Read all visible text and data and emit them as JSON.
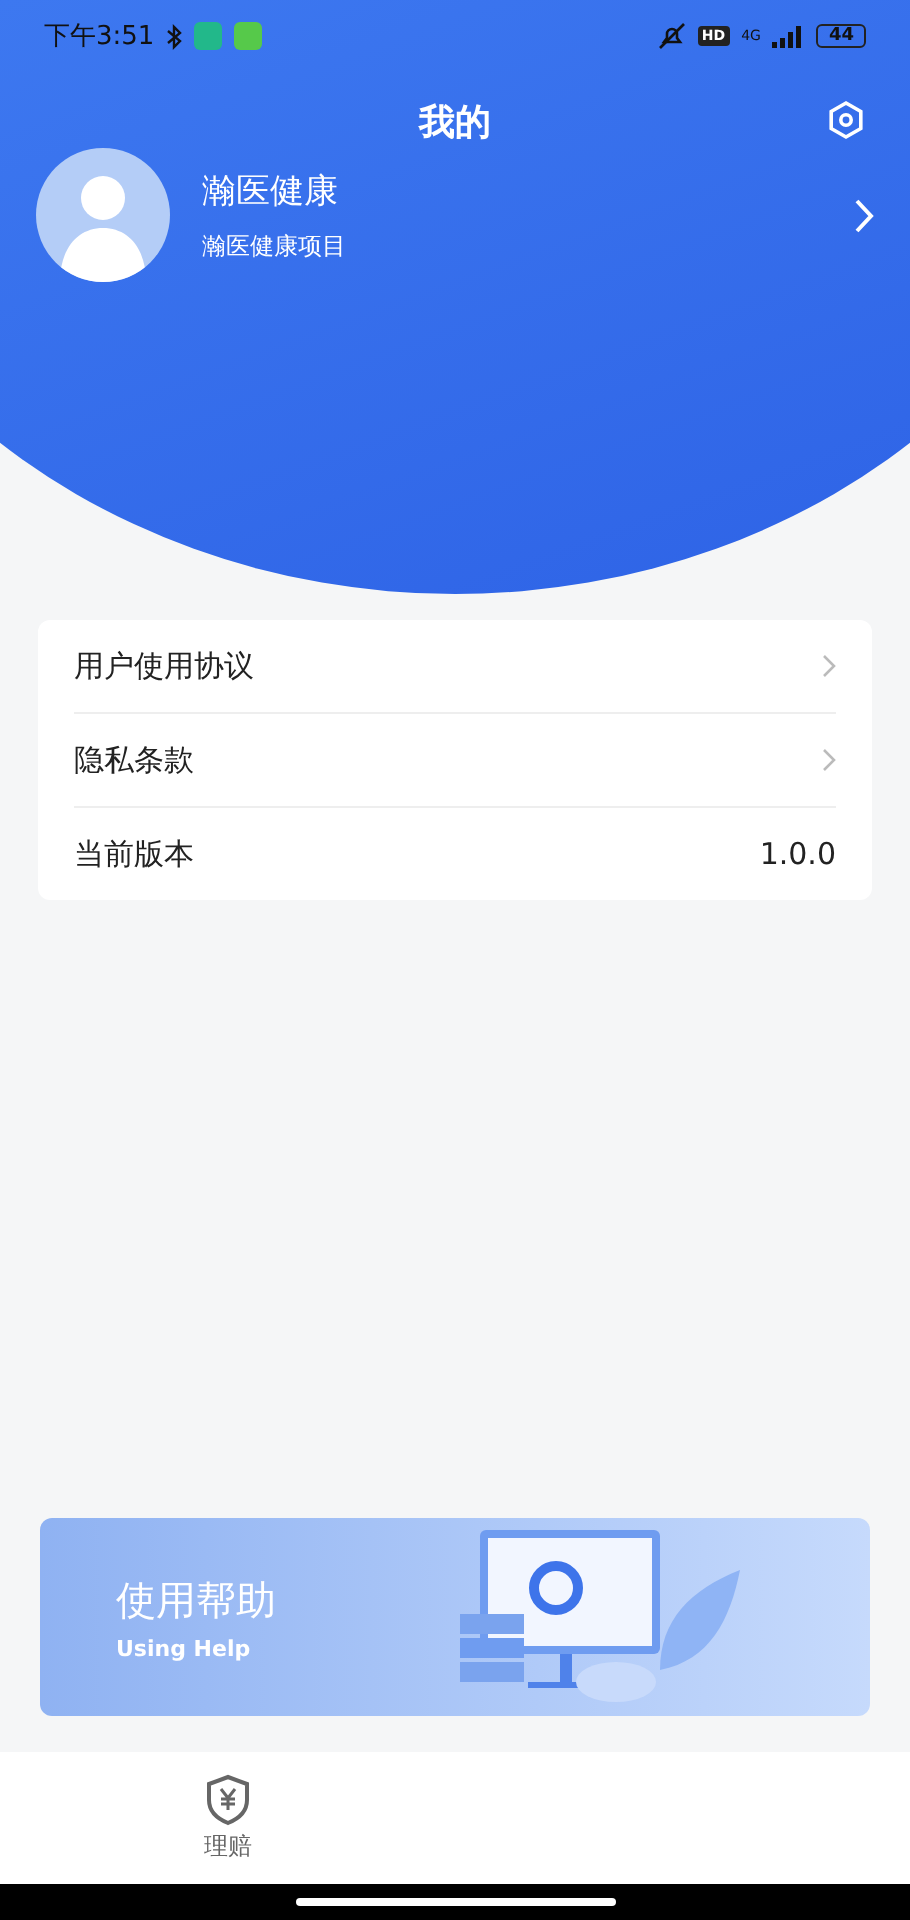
{
  "status_bar": {
    "time": "下午3:51",
    "hd": "HD",
    "network": "4G",
    "battery": "44"
  },
  "header": {
    "title": "我的"
  },
  "profile": {
    "name": "瀚医健康",
    "subtitle": "瀚医健康项目"
  },
  "menu": [
    {
      "kind": "link",
      "label": "用户使用协议"
    },
    {
      "kind": "link",
      "label": "隐私条款"
    },
    {
      "kind": "value",
      "label": "当前版本",
      "value": "1.0.0"
    }
  ],
  "help_banner": {
    "title": "使用帮助",
    "subtitle": "Using Help"
  },
  "tab_bar": {
    "tabs": [
      {
        "label": "理赔",
        "selected": false
      }
    ]
  }
}
